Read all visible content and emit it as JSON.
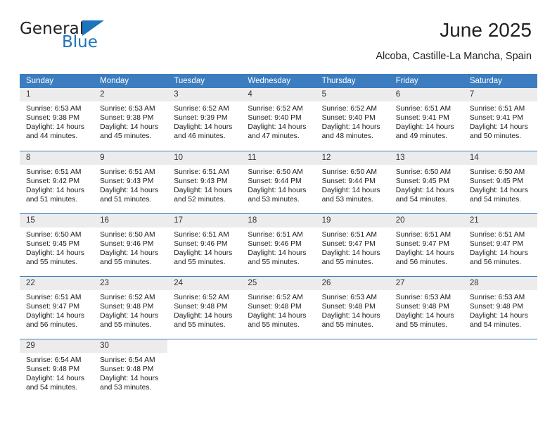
{
  "logo": {
    "primary_text": "General",
    "secondary_text": "Blue",
    "primary_color": "#231f20",
    "secondary_color": "#1d73bc"
  },
  "header": {
    "title": "June 2025",
    "subtitle": "Alcoba, Castille-La Mancha, Spain"
  },
  "theme": {
    "header_blue": "#3c7dc0",
    "daynum_gray": "#ececec",
    "text": "#1c1c1c"
  },
  "calendar": {
    "weekday_headers": [
      "Sunday",
      "Monday",
      "Tuesday",
      "Wednesday",
      "Thursday",
      "Friday",
      "Saturday"
    ],
    "weeks": [
      [
        {
          "day": "1",
          "sunrise": "Sunrise: 6:53 AM",
          "sunset": "Sunset: 9:38 PM",
          "daylight": "Daylight: 14 hours and 44 minutes."
        },
        {
          "day": "2",
          "sunrise": "Sunrise: 6:53 AM",
          "sunset": "Sunset: 9:38 PM",
          "daylight": "Daylight: 14 hours and 45 minutes."
        },
        {
          "day": "3",
          "sunrise": "Sunrise: 6:52 AM",
          "sunset": "Sunset: 9:39 PM",
          "daylight": "Daylight: 14 hours and 46 minutes."
        },
        {
          "day": "4",
          "sunrise": "Sunrise: 6:52 AM",
          "sunset": "Sunset: 9:40 PM",
          "daylight": "Daylight: 14 hours and 47 minutes."
        },
        {
          "day": "5",
          "sunrise": "Sunrise: 6:52 AM",
          "sunset": "Sunset: 9:40 PM",
          "daylight": "Daylight: 14 hours and 48 minutes."
        },
        {
          "day": "6",
          "sunrise": "Sunrise: 6:51 AM",
          "sunset": "Sunset: 9:41 PM",
          "daylight": "Daylight: 14 hours and 49 minutes."
        },
        {
          "day": "7",
          "sunrise": "Sunrise: 6:51 AM",
          "sunset": "Sunset: 9:41 PM",
          "daylight": "Daylight: 14 hours and 50 minutes."
        }
      ],
      [
        {
          "day": "8",
          "sunrise": "Sunrise: 6:51 AM",
          "sunset": "Sunset: 9:42 PM",
          "daylight": "Daylight: 14 hours and 51 minutes."
        },
        {
          "day": "9",
          "sunrise": "Sunrise: 6:51 AM",
          "sunset": "Sunset: 9:43 PM",
          "daylight": "Daylight: 14 hours and 51 minutes."
        },
        {
          "day": "10",
          "sunrise": "Sunrise: 6:51 AM",
          "sunset": "Sunset: 9:43 PM",
          "daylight": "Daylight: 14 hours and 52 minutes."
        },
        {
          "day": "11",
          "sunrise": "Sunrise: 6:50 AM",
          "sunset": "Sunset: 9:44 PM",
          "daylight": "Daylight: 14 hours and 53 minutes."
        },
        {
          "day": "12",
          "sunrise": "Sunrise: 6:50 AM",
          "sunset": "Sunset: 9:44 PM",
          "daylight": "Daylight: 14 hours and 53 minutes."
        },
        {
          "day": "13",
          "sunrise": "Sunrise: 6:50 AM",
          "sunset": "Sunset: 9:45 PM",
          "daylight": "Daylight: 14 hours and 54 minutes."
        },
        {
          "day": "14",
          "sunrise": "Sunrise: 6:50 AM",
          "sunset": "Sunset: 9:45 PM",
          "daylight": "Daylight: 14 hours and 54 minutes."
        }
      ],
      [
        {
          "day": "15",
          "sunrise": "Sunrise: 6:50 AM",
          "sunset": "Sunset: 9:45 PM",
          "daylight": "Daylight: 14 hours and 55 minutes."
        },
        {
          "day": "16",
          "sunrise": "Sunrise: 6:50 AM",
          "sunset": "Sunset: 9:46 PM",
          "daylight": "Daylight: 14 hours and 55 minutes."
        },
        {
          "day": "17",
          "sunrise": "Sunrise: 6:51 AM",
          "sunset": "Sunset: 9:46 PM",
          "daylight": "Daylight: 14 hours and 55 minutes."
        },
        {
          "day": "18",
          "sunrise": "Sunrise: 6:51 AM",
          "sunset": "Sunset: 9:46 PM",
          "daylight": "Daylight: 14 hours and 55 minutes."
        },
        {
          "day": "19",
          "sunrise": "Sunrise: 6:51 AM",
          "sunset": "Sunset: 9:47 PM",
          "daylight": "Daylight: 14 hours and 55 minutes."
        },
        {
          "day": "20",
          "sunrise": "Sunrise: 6:51 AM",
          "sunset": "Sunset: 9:47 PM",
          "daylight": "Daylight: 14 hours and 56 minutes."
        },
        {
          "day": "21",
          "sunrise": "Sunrise: 6:51 AM",
          "sunset": "Sunset: 9:47 PM",
          "daylight": "Daylight: 14 hours and 56 minutes."
        }
      ],
      [
        {
          "day": "22",
          "sunrise": "Sunrise: 6:51 AM",
          "sunset": "Sunset: 9:47 PM",
          "daylight": "Daylight: 14 hours and 56 minutes."
        },
        {
          "day": "23",
          "sunrise": "Sunrise: 6:52 AM",
          "sunset": "Sunset: 9:48 PM",
          "daylight": "Daylight: 14 hours and 55 minutes."
        },
        {
          "day": "24",
          "sunrise": "Sunrise: 6:52 AM",
          "sunset": "Sunset: 9:48 PM",
          "daylight": "Daylight: 14 hours and 55 minutes."
        },
        {
          "day": "25",
          "sunrise": "Sunrise: 6:52 AM",
          "sunset": "Sunset: 9:48 PM",
          "daylight": "Daylight: 14 hours and 55 minutes."
        },
        {
          "day": "26",
          "sunrise": "Sunrise: 6:53 AM",
          "sunset": "Sunset: 9:48 PM",
          "daylight": "Daylight: 14 hours and 55 minutes."
        },
        {
          "day": "27",
          "sunrise": "Sunrise: 6:53 AM",
          "sunset": "Sunset: 9:48 PM",
          "daylight": "Daylight: 14 hours and 55 minutes."
        },
        {
          "day": "28",
          "sunrise": "Sunrise: 6:53 AM",
          "sunset": "Sunset: 9:48 PM",
          "daylight": "Daylight: 14 hours and 54 minutes."
        }
      ],
      [
        {
          "day": "29",
          "sunrise": "Sunrise: 6:54 AM",
          "sunset": "Sunset: 9:48 PM",
          "daylight": "Daylight: 14 hours and 54 minutes."
        },
        {
          "day": "30",
          "sunrise": "Sunrise: 6:54 AM",
          "sunset": "Sunset: 9:48 PM",
          "daylight": "Daylight: 14 hours and 53 minutes."
        },
        {
          "day": "",
          "sunrise": "",
          "sunset": "",
          "daylight": ""
        },
        {
          "day": "",
          "sunrise": "",
          "sunset": "",
          "daylight": ""
        },
        {
          "day": "",
          "sunrise": "",
          "sunset": "",
          "daylight": ""
        },
        {
          "day": "",
          "sunrise": "",
          "sunset": "",
          "daylight": ""
        },
        {
          "day": "",
          "sunrise": "",
          "sunset": "",
          "daylight": ""
        }
      ]
    ]
  }
}
